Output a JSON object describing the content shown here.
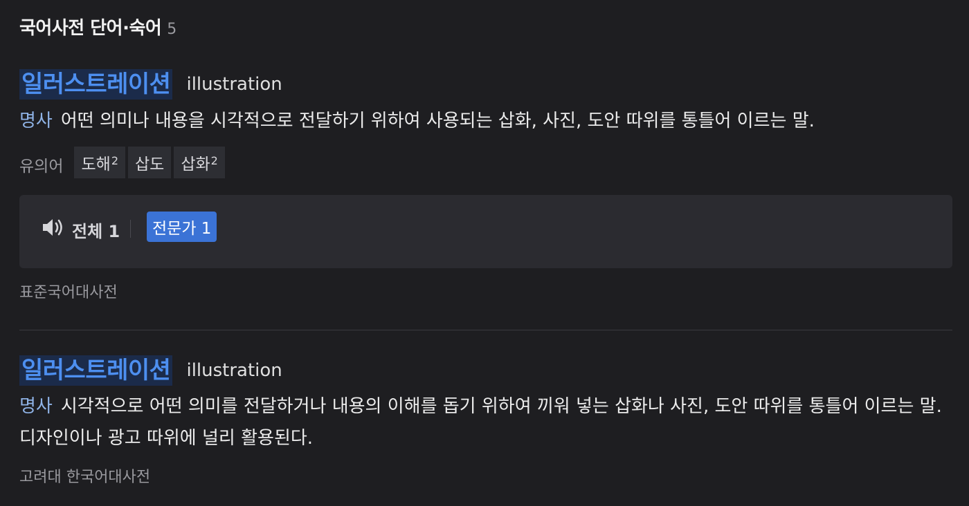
{
  "section": {
    "title": "국어사전 단어·숙어",
    "count": "5"
  },
  "entries": [
    {
      "headword": "일러스트레이션",
      "origin": "illustration",
      "pos": "명사",
      "definition": "어떤 의미나 내용을 시각적으로 전달하기 위하여 사용되는 삽화, 사진, 도안 따위를 통틀어 이르는 말.",
      "synonym_label": "유의어",
      "synonyms": [
        {
          "word": "도해",
          "sup": "2"
        },
        {
          "word": "삽도",
          "sup": ""
        },
        {
          "word": "삽화",
          "sup": "2"
        }
      ],
      "audio": {
        "icon": "speaker-icon",
        "all_label": "전체 1",
        "expert_label": "전문가 1"
      },
      "source": "표준국어대사전"
    },
    {
      "headword": "일러스트레이션",
      "origin": "illustration",
      "pos": "명사",
      "definition": "시각적으로 어떤 의미를 전달하거나 내용의 이해를 돕기 위하여 끼워 넣는 삽화나 사진, 도안 따위를 통틀어 이르는 말. 디자인이나 광고 따위에 널리 활용된다.",
      "source": "고려대 한국어대사전"
    }
  ],
  "colors": {
    "background": "#1e1e21",
    "headword": "#4d8ff0",
    "headword_bg": "#1b2b4a",
    "pos": "#8fb3e6",
    "expert_button": "#3b73d6"
  }
}
